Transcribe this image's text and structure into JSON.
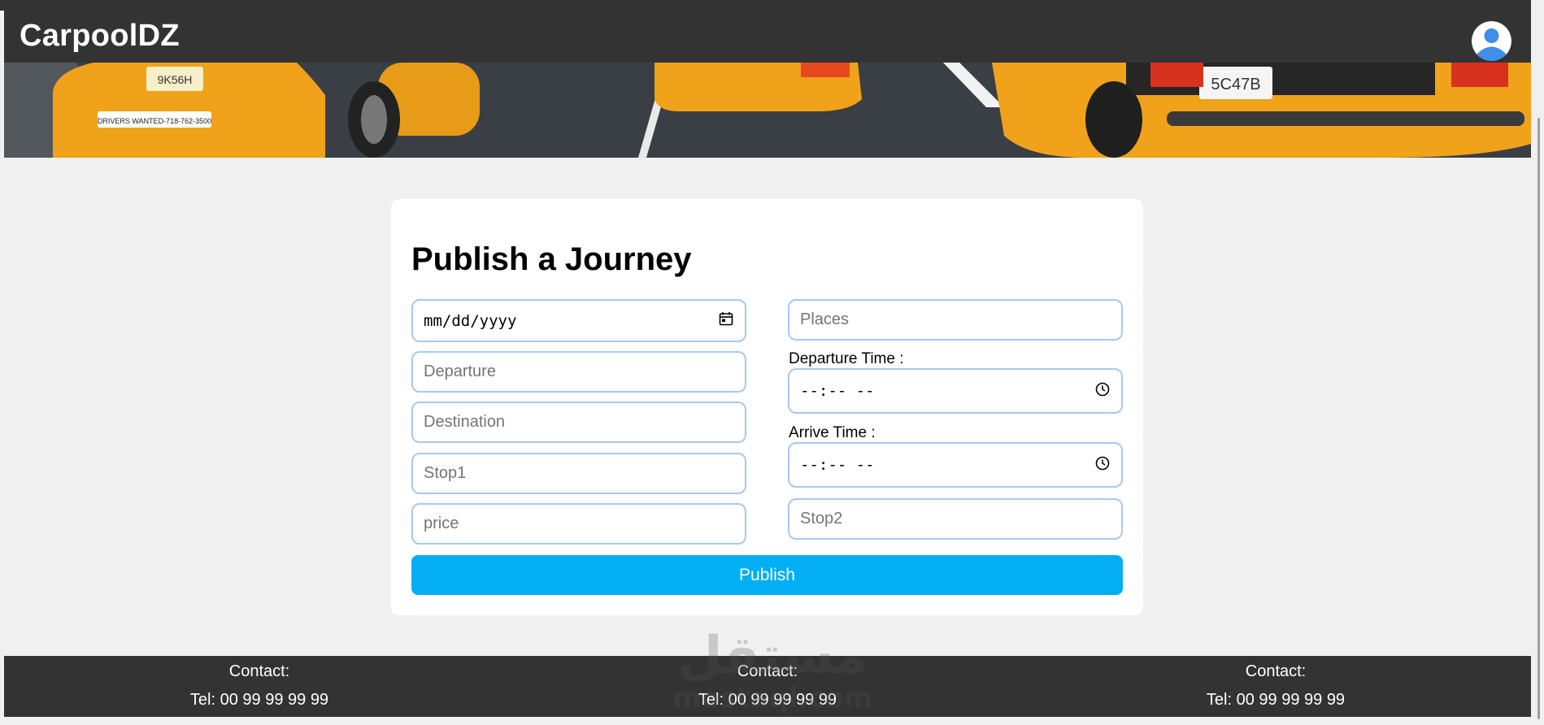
{
  "navbar": {
    "brand": "CarpoolDZ",
    "avatar_icon": "user-avatar-icon"
  },
  "banner": {
    "image": "yellow-taxis-photo",
    "plate_left": "9K56H",
    "plate_right": "5C47B",
    "ad_text": "DRIVERS WANTED-718-762-3500"
  },
  "form": {
    "title": "Publish a Journey",
    "date": {
      "value": "mm/dd/yyyy",
      "icon": "calendar-icon"
    },
    "departure": {
      "placeholder": "Departure"
    },
    "destination": {
      "placeholder": "Destination"
    },
    "stop1": {
      "placeholder": "Stop1"
    },
    "price": {
      "placeholder": "price"
    },
    "places": {
      "placeholder": "Places"
    },
    "departure_time": {
      "label": "Departure Time :",
      "value": "--:-- --",
      "icon": "clock-icon"
    },
    "arrive_time": {
      "label": "Arrive Time :",
      "value": "--:-- --",
      "icon": "clock-icon"
    },
    "stop2": {
      "placeholder": "Stop2"
    },
    "submit_label": "Publish"
  },
  "footer": {
    "columns": [
      {
        "title": "Contact:",
        "tel": "Tel: 00 99 99 99 99"
      },
      {
        "title": "Contact:",
        "tel": "Tel: 00 99 99 99 99"
      },
      {
        "title": "Contact:",
        "tel": "Tel: 00 99 99 99 99"
      }
    ]
  },
  "watermark": {
    "arabic": "مستقل",
    "latin": "mostaql.com"
  },
  "colors": {
    "nav": "#333333",
    "accent": "#03aef4",
    "field_border": "#a9c8ef",
    "page_bg": "#f0f0f0"
  }
}
